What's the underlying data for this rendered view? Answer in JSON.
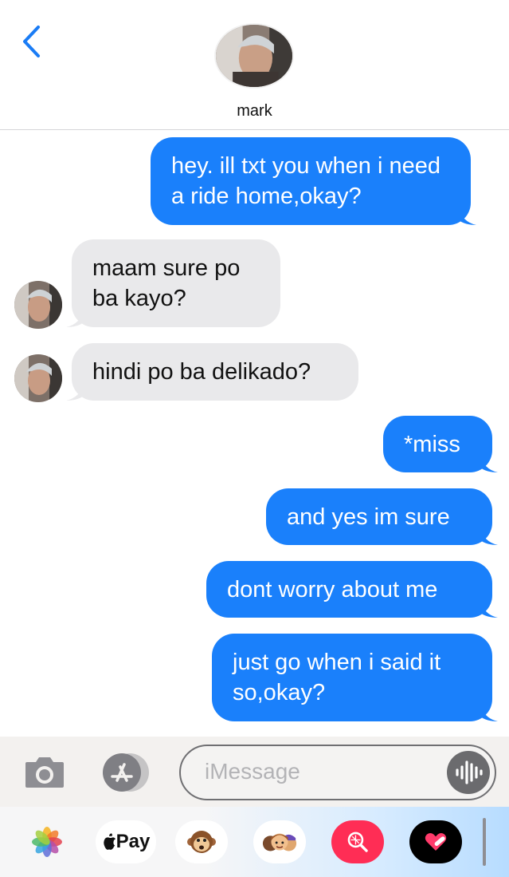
{
  "header": {
    "contact_name": "mark",
    "back_icon": "chevron-left-icon"
  },
  "messages": [
    {
      "from": "me",
      "lines": [
        "hey. ill txt you when i need",
        "a ride home,okay?"
      ]
    },
    {
      "from": "contact",
      "lines": [
        "maam sure po",
        "ba kayo?"
      ]
    },
    {
      "from": "contact",
      "lines": [
        "hindi po ba delikado?"
      ]
    },
    {
      "from": "me",
      "lines": [
        "*miss"
      ]
    },
    {
      "from": "me",
      "lines": [
        "and yes im sure"
      ]
    },
    {
      "from": "me",
      "lines": [
        "dont worry about me"
      ]
    },
    {
      "from": "me",
      "lines": [
        "just go when i said it",
        "so,okay?"
      ]
    }
  ],
  "input": {
    "placeholder": "iMessage",
    "camera_icon": "camera-icon",
    "apps_icon": "app-store-icon",
    "audio_icon": "audio-waveform-icon"
  },
  "drawer": {
    "apps": [
      {
        "name": "photos-icon"
      },
      {
        "name": "apple-pay-icon",
        "label": "Pay"
      },
      {
        "name": "monkey-animoji-icon"
      },
      {
        "name": "memoji-icon"
      },
      {
        "name": "image-search-icon"
      },
      {
        "name": "digital-touch-icon"
      }
    ]
  },
  "colors": {
    "sent_bubble": "#1a80fb",
    "received_bubble": "#e9e9eb",
    "accent": "#1a7cf5"
  }
}
